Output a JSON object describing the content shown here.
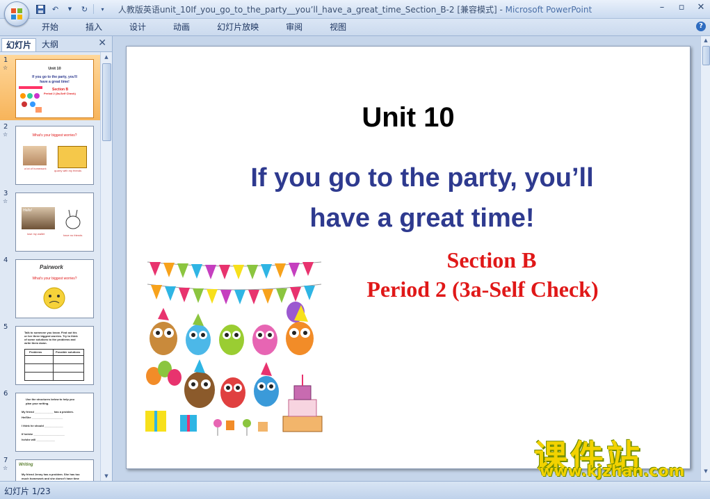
{
  "window": {
    "title_doc": "人教版英语unit_10If_you_go_to_the_party__you’ll_have_a_great_time_Section_B-2 [兼容模式]",
    "title_sep": " - ",
    "title_app": "Microsoft PowerPoint"
  },
  "ribbon": {
    "tabs": [
      "开始",
      "插入",
      "设计",
      "动画",
      "幻灯片放映",
      "审阅",
      "视图"
    ]
  },
  "pane": {
    "tab_slides": "幻灯片",
    "tab_outline": "大纲",
    "close": "✕",
    "thumbs": [
      {
        "num": "1",
        "lines": [
          "Unit 10",
          "If you go to the party, you'll",
          "have a great time!",
          "Section B",
          "Period 2 (3a-Self Check)"
        ]
      },
      {
        "num": "2",
        "lines": [
          "What’s your biggest worries?",
          "a lot of homework",
          "quarry with my friends"
        ]
      },
      {
        "num": "3",
        "lines": [
          "Hello!",
          "lose my wallet",
          "have no friends"
        ]
      },
      {
        "num": "4",
        "lines": [
          "Pairwork",
          "What’s your biggest worries?"
        ]
      },
      {
        "num": "5",
        "lines": [
          "Talk to someone you know. Find out his",
          "or her three biggest worries. Try to think",
          "of some solutions to the problems and",
          "write them down.",
          "Problems",
          "Possible solutions"
        ]
      },
      {
        "num": "6",
        "lines": [
          "Use the structures below to help you",
          "plan your writing.",
          "My friend ____________ has a problem.",
          "He/She ____________________",
          "I think he should ____________",
          "If he/she ____________________",
          "he/she will ____________"
        ]
      },
      {
        "num": "7",
        "lines": [
          "Writing",
          "My friend Jenny has a problem. She has too",
          "much homework and she doesn’t have time"
        ]
      }
    ]
  },
  "slide": {
    "unit": "Unit 10",
    "title_line1": "If you go to the party, you’ll",
    "title_line2": "have a great time!",
    "section": "Section B",
    "period": "Period 2 (3a-Self Check)"
  },
  "watermark": {
    "cn": "课件站",
    "url": "www.kjzhan.com"
  },
  "status": {
    "slide_info": "幻灯片 1/23"
  },
  "colors": {
    "title_blue": "#2e3a8f",
    "section_red": "#e01818",
    "selected_thumb": "#f7b45a",
    "watermark_yellow": "#f2d200"
  }
}
